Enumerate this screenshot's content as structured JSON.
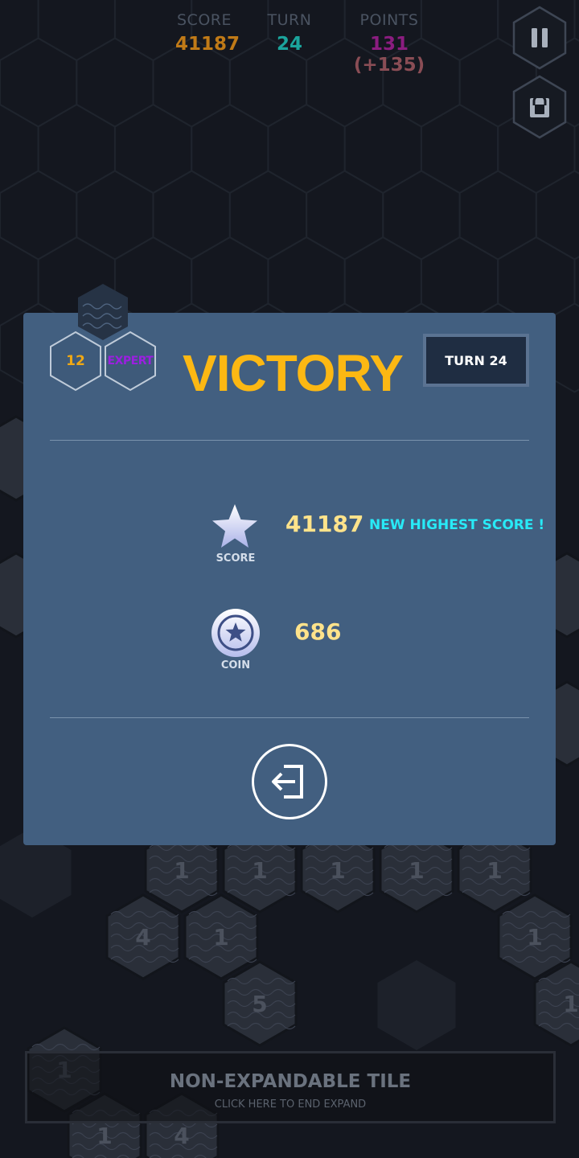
{
  "hud": {
    "score_label": "SCORE",
    "score_value": "41187",
    "turn_label": "TURN",
    "turn_value": "24",
    "points_label": "POINTS",
    "points_value": "131",
    "points_delta": "(+135)",
    "score_color": "#c07a17",
    "turn_color": "#1ba49c",
    "pause_icon": "pause-icon",
    "lock_icon": "lock-icon"
  },
  "dialog": {
    "level": "12",
    "difficulty": "EXPERT",
    "title": "VICTORY",
    "turn_badge": "TURN 24",
    "score_caption": "SCORE",
    "score_value": "41187",
    "new_high_label": "NEW HIGHEST SCORE !",
    "coin_caption": "COIN",
    "coin_value": "686",
    "exit_icon": "exit-icon"
  },
  "background_tiles": [
    "1",
    "1",
    "1",
    "1",
    "1",
    "4",
    "1",
    "5",
    "1",
    "1",
    "1",
    "4",
    "1"
  ],
  "bottom_bar": {
    "title": "NON-EXPANDABLE TILE",
    "subtitle": "CLICK HERE TO END EXPAND"
  }
}
